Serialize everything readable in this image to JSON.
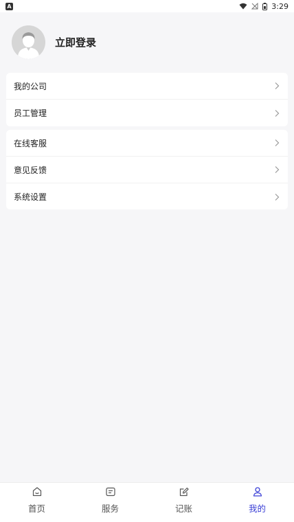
{
  "status_bar": {
    "time": "3:29",
    "app_badge": "A"
  },
  "profile": {
    "login_label": "立即登录"
  },
  "menu_group_1": [
    {
      "label": "我的公司"
    },
    {
      "label": "员工管理"
    }
  ],
  "menu_group_2": [
    {
      "label": "在线客服"
    },
    {
      "label": "意见反馈"
    },
    {
      "label": "系统设置"
    }
  ],
  "tabbar": {
    "active": "我的",
    "tabs": [
      {
        "label": "首页",
        "icon": "home-icon"
      },
      {
        "label": "服务",
        "icon": "service-icon"
      },
      {
        "label": "记账",
        "icon": "edit-icon"
      },
      {
        "label": "我的",
        "icon": "profile-icon"
      }
    ]
  },
  "colors": {
    "accent": "#3a3fd6",
    "background": "#f6f6f8",
    "card": "#ffffff"
  }
}
